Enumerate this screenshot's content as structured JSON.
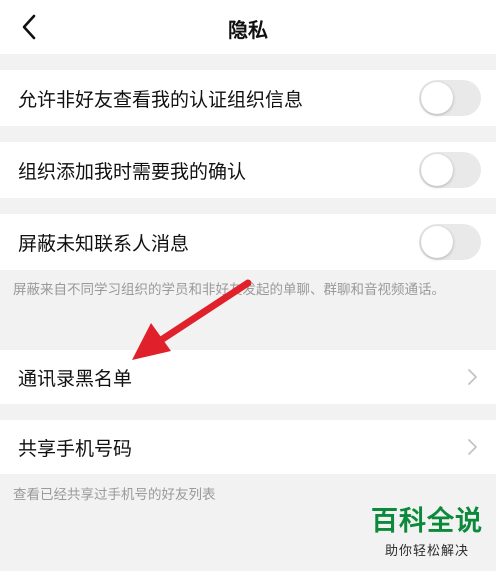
{
  "header": {
    "title": "隐私",
    "back_icon": "chevron-left-icon"
  },
  "settings": {
    "allow_non_friends": {
      "label": "允许非好友查看我的认证组织信息",
      "enabled": false
    },
    "org_confirm": {
      "label": "组织添加我时需要我的确认",
      "enabled": false
    },
    "block_unknown": {
      "label": "屏蔽未知联系人消息",
      "enabled": false
    }
  },
  "notes": {
    "block_unknown": "屏蔽来自不同学习组织的学员和非好友发起的单聊、群聊和音视频通话。",
    "share_phone": "查看已经共享过手机号的好友列表"
  },
  "links": {
    "blacklist": {
      "label": "通讯录黑名单",
      "icon": "chevron-right-icon"
    },
    "share_phone": {
      "label": "共享手机号码",
      "icon": "chevron-right-icon"
    }
  },
  "annotation": {
    "color": "#e0202a",
    "icon": "red-arrow"
  },
  "watermark": {
    "main": "百科全说",
    "sub": "助你轻松解决",
    "color": "#0c8a3b"
  },
  "colors": {
    "background": "#f2f2f2",
    "toggle_off": "#e9e9ea"
  }
}
